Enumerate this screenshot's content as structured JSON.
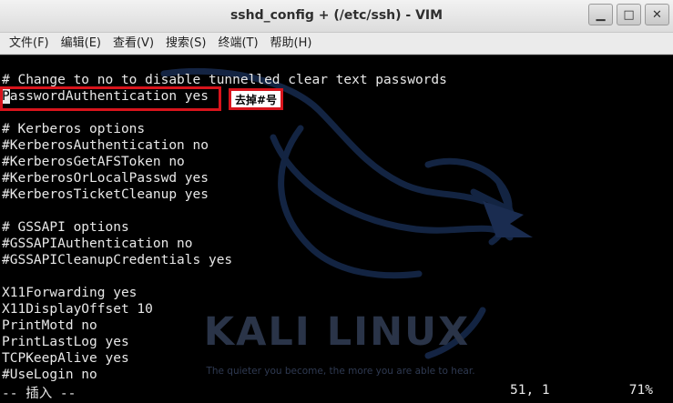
{
  "window": {
    "title": "sshd_config + (/etc/ssh) - VIM",
    "minimize_glyph": "▁",
    "maximize_glyph": "□",
    "close_glyph": "✕"
  },
  "menu": [
    "文件(F)",
    "编辑(E)",
    "查看(V)",
    "搜索(S)",
    "终端(T)",
    "帮助(H)"
  ],
  "editor": {
    "lines": [
      "# Change to no to disable tunnelled clear text passwords",
      "PasswordAuthentication yes",
      "",
      "# Kerberos options",
      "#KerberosAuthentication no",
      "#KerberosGetAFSToken no",
      "#KerberosOrLocalPasswd yes",
      "#KerberosTicketCleanup yes",
      "",
      "# GSSAPI options",
      "#GSSAPIAuthentication no",
      "#GSSAPICleanupCredentials yes",
      "",
      "X11Forwarding yes",
      "X11DisplayOffset 10",
      "PrintMotd no",
      "PrintLastLog yes",
      "TCPKeepAlive yes",
      "#UseLogin no"
    ],
    "cursor_char": "P",
    "cursor_line_rest": "asswordAuthentication yes"
  },
  "annotation": {
    "note": "去掉#号",
    "color": "#d8141c"
  },
  "background": {
    "logo_text": "KALI LINUX",
    "slogan": "The quieter you become, the more you are able to hear."
  },
  "status": {
    "mode": "-- 插入 --",
    "position": "51, 1",
    "percent": "71%"
  }
}
